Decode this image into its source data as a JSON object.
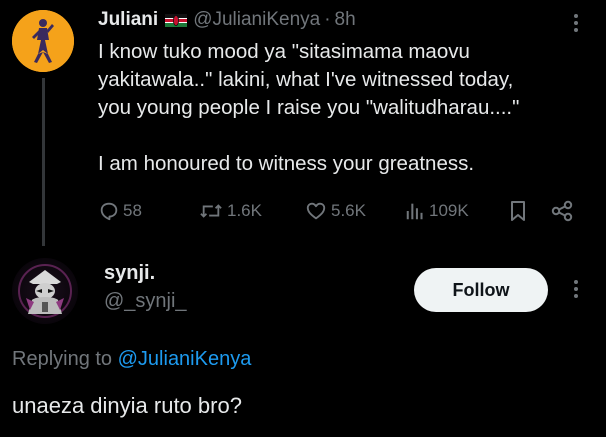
{
  "original_tweet": {
    "author_name": "Juliani",
    "handle": "@JulianiKenya",
    "separator": "·",
    "time": "8h",
    "flag_icon": "kenya-flag-icon",
    "avatar_color": "#f5a21a",
    "text_lines": [
      "I know tuko mood ya \"sitasimama maovu",
      "yakitawala..\" lakini, what I've witnessed today,",
      "you young people I raise you \"walitudharau....\""
    ],
    "text_line_last": "I am honoured to witness your greatness.",
    "actions": {
      "replies": "58",
      "reposts": "1.6K",
      "likes": "5.6K",
      "views": "109K"
    }
  },
  "reply_tweet": {
    "author_name": "synji.",
    "handle": "@_synji_",
    "follow_label": "Follow",
    "replying_prefix": "Replying to",
    "replying_to": "@JulianiKenya",
    "text": "unaeza dinyia ruto bro?"
  },
  "colors": {
    "background": "#000000",
    "text_primary": "#e7e9ea",
    "text_secondary": "#71767b",
    "accent_link": "#1d9bf0",
    "follow_button_bg": "#eff3f4"
  }
}
